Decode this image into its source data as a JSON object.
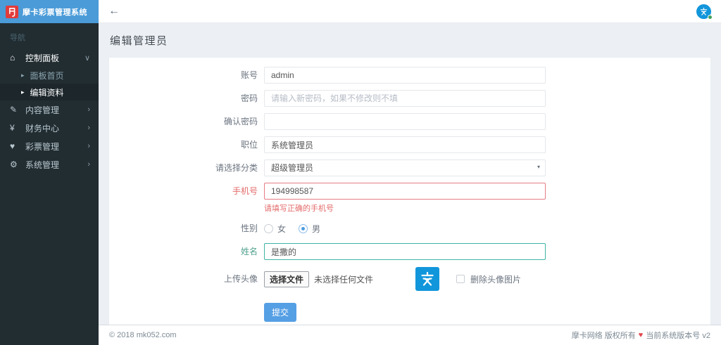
{
  "brand": {
    "title": "摩卡彩票管理系统"
  },
  "icons": {
    "back": "←",
    "home": "⌂",
    "content": "✎",
    "finance": "¥",
    "lottery": "♥",
    "system": "⚙",
    "chevron_down": "∨",
    "chevron_right": "›",
    "caret_right": "▸",
    "select_arrow": "▾"
  },
  "sidebar": {
    "nav_label": "导航",
    "menu": [
      {
        "label": "控制面板",
        "children": [
          {
            "label": "面板首页"
          },
          {
            "label": "编辑资料"
          }
        ]
      },
      {
        "label": "内容管理"
      },
      {
        "label": "财务中心"
      },
      {
        "label": "彩票管理"
      },
      {
        "label": "系统管理"
      }
    ]
  },
  "page": {
    "title": "编辑管理员"
  },
  "form": {
    "account": {
      "label": "账号",
      "value": "admin"
    },
    "password": {
      "label": "密码",
      "placeholder": "请输入新密码，如果不修改则不填"
    },
    "confirm_password": {
      "label": "确认密码",
      "value": ""
    },
    "position": {
      "label": "职位",
      "value": "系统管理员"
    },
    "category": {
      "label": "请选择分类",
      "value": "超级管理员"
    },
    "phone": {
      "label": "手机号",
      "value": "194998587",
      "error": "请填写正确的手机号"
    },
    "gender": {
      "label": "性别",
      "options": [
        "女",
        "男"
      ],
      "selected": "男"
    },
    "name": {
      "label": "姓名",
      "value": "是撒的"
    },
    "avatar": {
      "label": "上传头像",
      "choose_file": "选择文件",
      "no_file": "未选择任何文件",
      "delete_label": "删除头像图片"
    },
    "submit_label": "提交"
  },
  "footer": {
    "copyright": "© 2018 mk052.com",
    "rights": "摩卡网络 版权所有",
    "heart": "♥",
    "version": "当前系统版本号 v2"
  },
  "colors": {
    "header_blue": "#4a9bd8",
    "sidebar_dark": "#222d32",
    "accent_blue": "#559fe4",
    "error_red": "#e46b6b",
    "valid_teal": "#3fb5a3",
    "alipay_blue": "#1296db",
    "logo_red": "#e23b3b"
  }
}
